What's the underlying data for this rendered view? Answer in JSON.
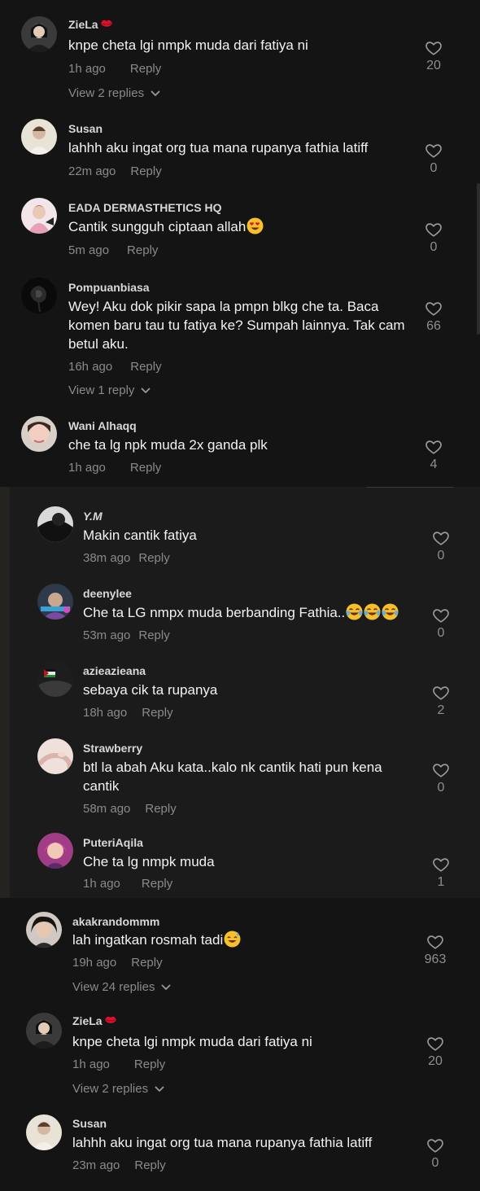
{
  "colors": {
    "background": "#141414",
    "nested_background": "#1b1b1b",
    "text": "#f2f2f2",
    "muted": "#8a8a8a",
    "emoji": "#f6c02d",
    "lips": "#e0102a"
  },
  "icons": {
    "like": "heart-outline-icon",
    "expand": "chevron-down-icon",
    "lips": "kiss-lips-emoji",
    "heart_eyes": "heart-eyes-emoji",
    "tears_of_joy": "tears-of-joy-emoji",
    "sweat_smile": "sweat-smile-emoji"
  },
  "comments": [
    {
      "username": "ZieLa",
      "text": "knpe cheta lgi nmpk muda dari fatiya ni",
      "time": "1h ago",
      "reply": "Reply",
      "likes": "20",
      "view_replies": "View 2 replies"
    },
    {
      "username": "Susan",
      "text": "lahhh aku ingat org tua mana rupanya fathia latiff",
      "time": "22m ago",
      "reply": "Reply",
      "likes": "0"
    },
    {
      "username": "EADA DERMASTHETICS HQ",
      "text": "Cantik sungguh ciptaan allah",
      "time": "5m ago",
      "reply": "Reply",
      "likes": "0"
    },
    {
      "username": "Pompuanbiasa",
      "text": "Wey! Aku dok pikir sapa la pmpn blkg che ta. Baca komen baru tau tu fatiya ke? Sumpah lainnya. Tak cam betul aku.",
      "time": "16h ago",
      "reply": "Reply",
      "likes": "66",
      "view_replies": "View 1 reply"
    },
    {
      "username": "Wani Alhaqq",
      "text": "che ta lg npk muda 2x ganda plk",
      "time": "1h ago",
      "reply": "Reply",
      "likes": "4"
    }
  ],
  "nested": [
    {
      "username": "Y.M",
      "text": "Makin cantik fatiya",
      "time": "38m ago",
      "reply": "Reply",
      "likes": "0"
    },
    {
      "username": "deenylee",
      "text": "Che ta LG nmpx muda berbanding Fathia..",
      "time": "53m ago",
      "reply": "Reply",
      "likes": "0"
    },
    {
      "username": "azieazieana",
      "text": "sebaya cik ta rupanya",
      "time": "18h ago",
      "reply": "Reply",
      "likes": "2"
    },
    {
      "username": "Strawberry",
      "text": "btl la abah Aku kata..kalo nk cantik hati pun kena cantik",
      "time": "58m ago",
      "reply": "Reply",
      "likes": "0"
    },
    {
      "username": "PuteriAqila",
      "text": "Che ta lg nmpk muda",
      "time": "1h ago",
      "reply": "Reply",
      "likes": "1"
    }
  ],
  "bottom": [
    {
      "username": "akakrandommm",
      "text": "lah ingatkan rosmah tadi",
      "time": "19h ago",
      "reply": "Reply",
      "likes": "963",
      "view_replies": "View 24 replies"
    },
    {
      "username": "ZieLa",
      "text": "knpe cheta lgi nmpk muda dari fatiya ni",
      "time": "1h ago",
      "reply": "Reply",
      "likes": "20",
      "view_replies": "View 2 replies"
    },
    {
      "username": "Susan",
      "text": "lahhh aku ingat org tua mana rupanya fathia latiff",
      "time": "23m ago",
      "reply": "Reply",
      "likes": "0"
    }
  ]
}
